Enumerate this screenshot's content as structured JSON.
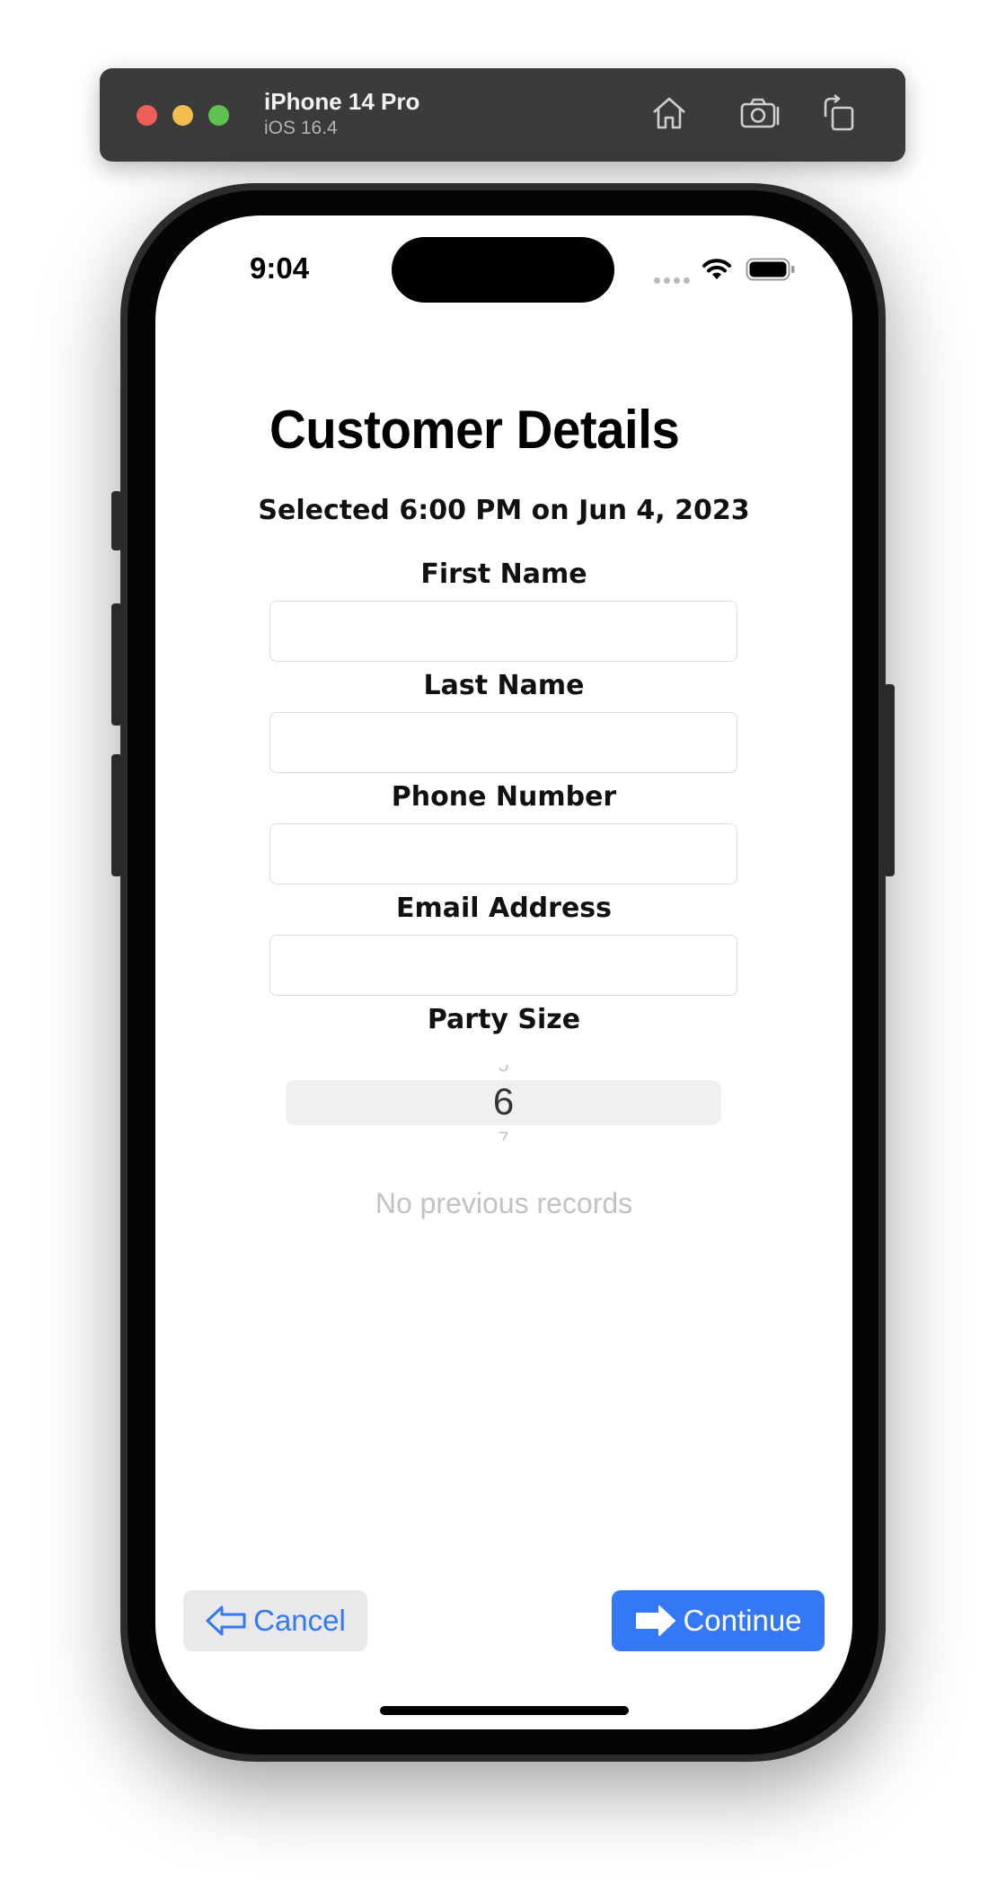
{
  "simulator": {
    "device": "iPhone 14 Pro",
    "os": "iOS 16.4",
    "icons": [
      "home-icon",
      "screenshot-icon",
      "rotate-icon"
    ]
  },
  "status_bar": {
    "time": "9:04",
    "icons": [
      "cellular-icon",
      "wifi-icon",
      "battery-icon"
    ]
  },
  "page": {
    "title": "Customer Details",
    "selected_text": "Selected 6:00 PM on Jun 4, 2023"
  },
  "form": {
    "first_name": {
      "label": "First Name",
      "value": ""
    },
    "last_name": {
      "label": "Last Name",
      "value": ""
    },
    "phone_number": {
      "label": "Phone Number",
      "value": ""
    },
    "email_address": {
      "label": "Email Address",
      "value": ""
    },
    "party_size": {
      "label": "Party Size",
      "selected": "6",
      "prev": "5",
      "next": "7"
    }
  },
  "records": {
    "empty_text": "No previous records"
  },
  "actions": {
    "cancel_label": "Cancel",
    "continue_label": "Continue"
  },
  "colors": {
    "accent": "#3478f6",
    "cancel_bg": "#e9e9eb",
    "placeholder_text": "#c2c2c2"
  }
}
